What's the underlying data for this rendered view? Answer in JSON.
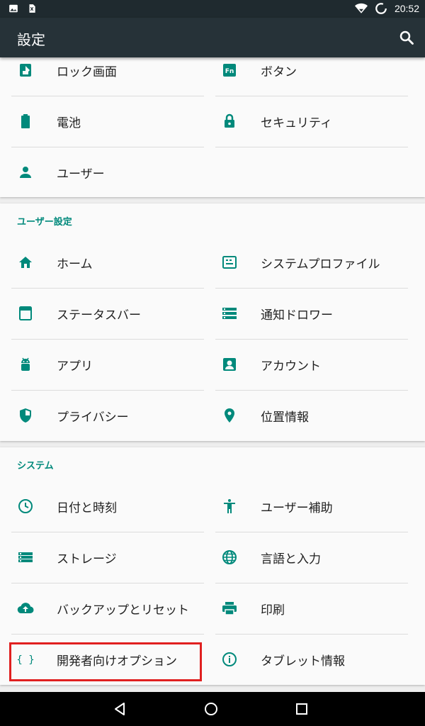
{
  "status_bar": {
    "time": "20:52",
    "left_icons": [
      "image-icon",
      "sim-card-icon"
    ],
    "right_icons": [
      "wifi-icon",
      "battery-charging-icon"
    ]
  },
  "app_bar": {
    "title": "設定",
    "search_icon": "search-icon"
  },
  "sections": [
    {
      "title": "",
      "tiles": [
        {
          "label": "ロック画面",
          "icon": "lock-screen-icon"
        },
        {
          "label": "ボタン",
          "icon": "fn-key-icon"
        },
        {
          "label": "電池",
          "icon": "battery-icon"
        },
        {
          "label": "セキュリティ",
          "icon": "lock-icon"
        },
        {
          "label": "ユーザー",
          "icon": "person-icon"
        }
      ]
    },
    {
      "title": "ユーザー設定",
      "tiles": [
        {
          "label": "ホーム",
          "icon": "home-icon"
        },
        {
          "label": "システムプロファイル",
          "icon": "system-profile-icon"
        },
        {
          "label": "ステータスバー",
          "icon": "status-bar-icon"
        },
        {
          "label": "通知ドロワー",
          "icon": "notification-drawer-icon"
        },
        {
          "label": "アプリ",
          "icon": "android-icon"
        },
        {
          "label": "アカウント",
          "icon": "account-icon"
        },
        {
          "label": "プライバシー",
          "icon": "privacy-shield-icon"
        },
        {
          "label": "位置情報",
          "icon": "location-pin-icon"
        }
      ]
    },
    {
      "title": "システム",
      "tiles": [
        {
          "label": "日付と時刻",
          "icon": "clock-icon"
        },
        {
          "label": "ユーザー補助",
          "icon": "accessibility-icon"
        },
        {
          "label": "ストレージ",
          "icon": "storage-icon"
        },
        {
          "label": "言語と入力",
          "icon": "globe-icon"
        },
        {
          "label": "バックアップとリセット",
          "icon": "cloud-upload-icon"
        },
        {
          "label": "印刷",
          "icon": "print-icon"
        },
        {
          "label": "開発者向けオプション",
          "icon": "developer-braces-icon"
        },
        {
          "label": "タブレット情報",
          "icon": "info-icon"
        }
      ]
    }
  ],
  "highlighted_item": "開発者向けオプション",
  "nav_bar": {
    "back_icon": "back-triangle-icon",
    "home_icon": "home-circle-icon",
    "recents_icon": "recents-square-icon"
  },
  "colors": {
    "accent": "#00897b",
    "app_bar": "#263238",
    "status_bar": "#1f2a2f",
    "highlight": "#e02020"
  }
}
